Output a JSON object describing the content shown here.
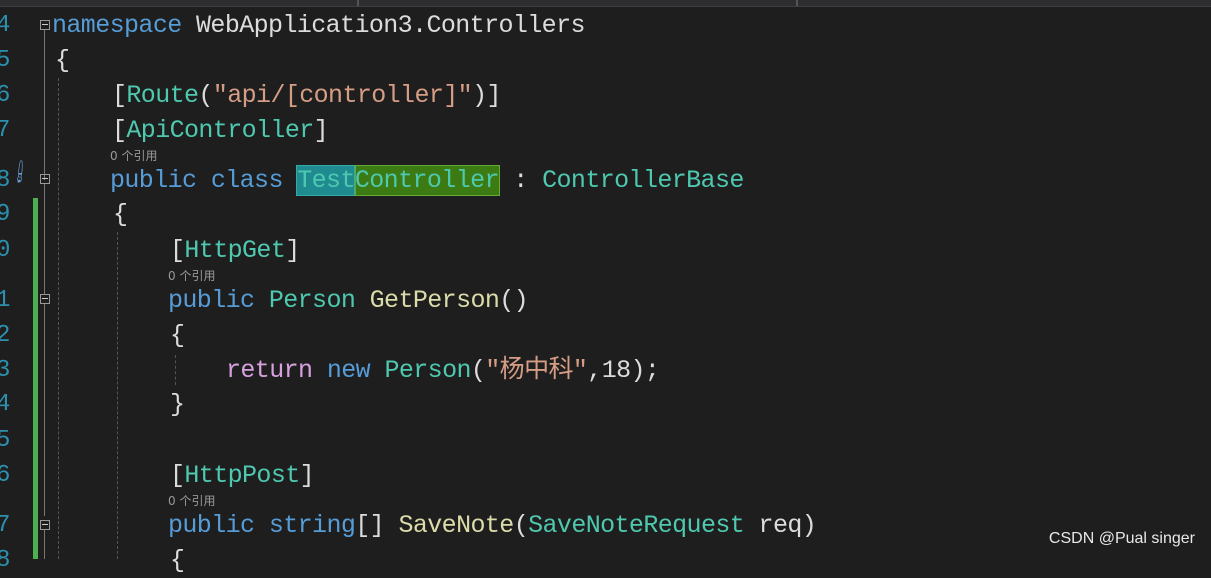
{
  "line_numbers": [
    "4",
    "5",
    "6",
    "7",
    "8",
    "9",
    "0",
    "1",
    "2",
    "3",
    "4",
    "5",
    "6",
    "7",
    "8"
  ],
  "codelens": "0 个引用",
  "code": {
    "l4": {
      "kw": "namespace",
      "rest": " WebApplication3.Controllers"
    },
    "l5": "{",
    "l6": {
      "open": "[",
      "attr": "Route",
      "p1": "(",
      "str": "\"api/[controller]\"",
      "close": ")]"
    },
    "l7": {
      "open": "[",
      "attr": "ApiController",
      "close": "]"
    },
    "l8": {
      "kw1": "public",
      "kw2": "class",
      "name_a": "Test",
      "name_b": "Controller",
      "colon": " : ",
      "base": "ControllerBase"
    },
    "l9": "{",
    "l10": {
      "open": "[",
      "attr": "HttpGet",
      "close": "]"
    },
    "l11": {
      "kw": "public",
      "type": "Person",
      "method": "GetPerson",
      "paren": "()"
    },
    "l12": "{",
    "l13": {
      "ret": "return",
      "kw": "new",
      "type": "Person",
      "p1": "(",
      "str": "\"杨中科\"",
      "rest": ",18);"
    },
    "l14": "}",
    "l16": {
      "open": "[",
      "attr": "HttpPost",
      "close": "]"
    },
    "l17": {
      "kw": "public",
      "kw2": "string",
      "br": "[]",
      "method": "SaveNote",
      "p1": "(",
      "type": "SaveNoteRequest",
      "rest": " req)"
    },
    "l18": "{"
  },
  "watermark": "CSDN @Pual singer",
  "colors": {
    "background": "#1e1e1e",
    "keyword": "#569cd6",
    "type": "#4ec9b0",
    "string": "#d69d85",
    "method": "#dcdcaa",
    "control": "#d8a0df",
    "change_bar": "#4caf50"
  }
}
